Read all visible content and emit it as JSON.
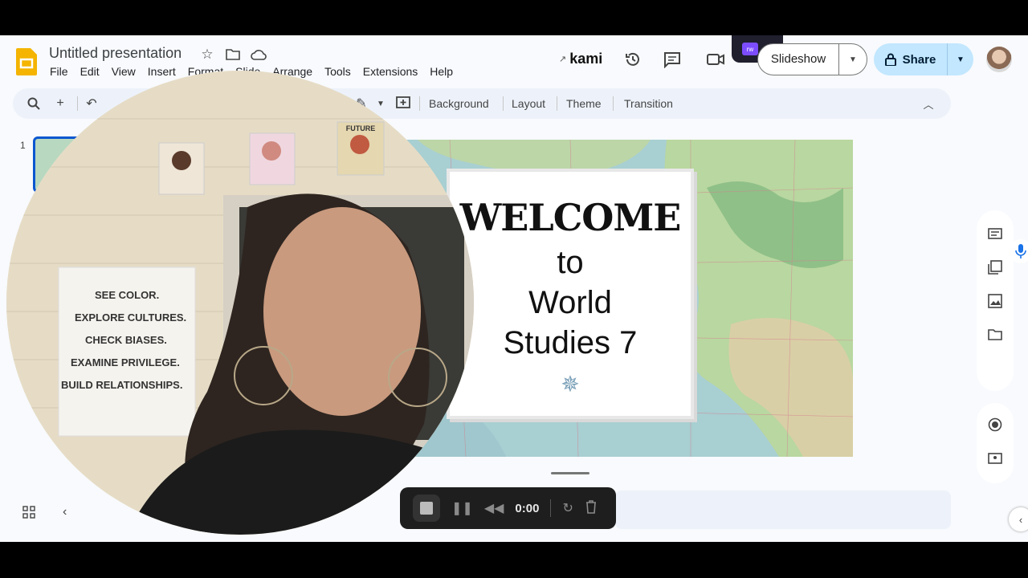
{
  "header": {
    "title": "Untitled presentation",
    "menu": [
      "File",
      "Edit",
      "View",
      "Insert",
      "Format",
      "Slide",
      "Arrange",
      "Tools",
      "Extensions",
      "Help"
    ],
    "kami_label": "kami",
    "extension_badge": "rw",
    "slideshow_label": "Slideshow",
    "share_label": "Share"
  },
  "toolbar": {
    "background_label": "Background",
    "layout_label": "Layout",
    "theme_label": "Theme",
    "transition_label": "Transition"
  },
  "filmstrip": {
    "slide_number": "1"
  },
  "slide": {
    "heading": "WELCOME",
    "line1": "to",
    "line2": "World",
    "line3": "Studies 7"
  },
  "webcam": {
    "poster_lines": [
      "SEE COLOR.",
      "EXPLORE CULTURES.",
      "CHECK BIASES.",
      "EXAMINE PRIVILEGE.",
      "BUILD RELATIONSHIPS."
    ],
    "poster_top_label": "FUTURE"
  },
  "recorder": {
    "time": "0:00"
  },
  "colors": {
    "accent": "#0b57d0",
    "share_bg": "#c2e7ff",
    "slides_yellow": "#f4b400"
  },
  "icons": [
    "slides-logo-icon",
    "star-icon",
    "move-folder-icon",
    "cloud-icon",
    "history-icon",
    "comment-icon",
    "camera-icon",
    "lock-icon",
    "search-icon",
    "plus-icon",
    "undo-icon",
    "add-comment-icon",
    "collapse-icon"
  ]
}
